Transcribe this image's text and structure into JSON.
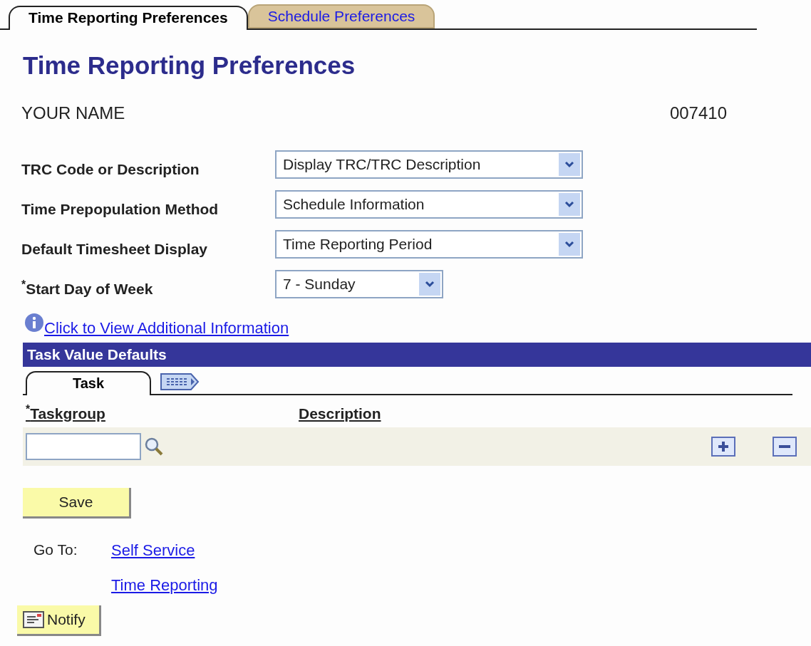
{
  "tabs": [
    {
      "label": "Time Reporting Preferences",
      "selected": true
    },
    {
      "label": "Schedule Preferences",
      "selected": false
    }
  ],
  "page_title": "Time Reporting Preferences",
  "employee": {
    "name": "YOUR NAME",
    "id": "007410"
  },
  "fields": [
    {
      "label": "TRC Code or Description",
      "value": "Display TRC/TRC Description",
      "wide": true
    },
    {
      "label": "Time Prepopulation Method",
      "value": "Schedule Information",
      "wide": true
    },
    {
      "label": "Default Timesheet Display",
      "value": "Time Reporting Period",
      "wide": true
    },
    {
      "label": "$^{*}$Start Day of Week",
      "value": "7 - Sunday",
      "wide": false
    }
  ],
  "info_link": "Click to View Additional Information",
  "task_section": {
    "title": "Task Value Defaults",
    "tabs": [
      {
        "label": "Task",
        "selected": true
      }
    ],
    "columns": [
      "$^{*}$Taskgroup",
      "Description"
    ]
  },
  "save_button": "Save",
  "goto": {
    "label": "Go To:",
    "links": [
      "Self Service",
      "Time Reporting"
    ]
  },
  "notify_button": "Notify"
}
